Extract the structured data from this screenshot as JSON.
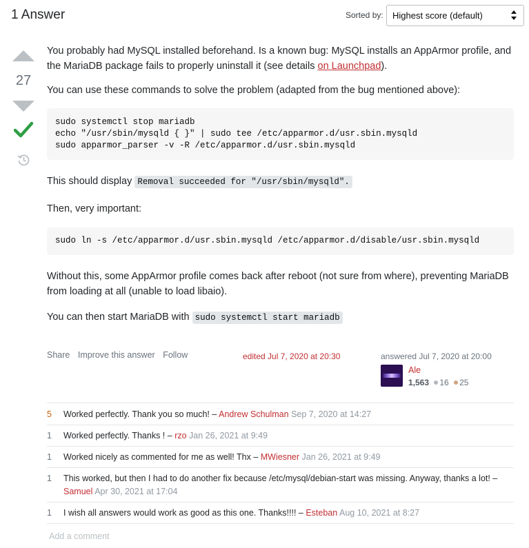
{
  "header": {
    "answers_count": "1 Answer",
    "sorted_label": "Sorted by:",
    "sort_value": "Highest score (default)"
  },
  "vote": {
    "count": "27"
  },
  "post": {
    "p1_a": "You probably had MySQL installed beforehand. Is a known bug: MySQL installs an AppArmor profile, and the MariaDB package fails to properly uninstall it (see details ",
    "p1_link": "on Launchpad",
    "p1_b": ").",
    "p2": "You can use these commands to solve the problem (adapted from the bug mentioned above):",
    "code1": "sudo systemctl stop mariadb\necho \"/usr/sbin/mysqld { }\" | sudo tee /etc/apparmor.d/usr.sbin.mysqld\nsudo apparmor_parser -v -R /etc/apparmor.d/usr.sbin.mysqld",
    "p3": "This should display ",
    "p3_code": "Removal succeeded for \"/usr/sbin/mysqld\".",
    "p4": "Then, very important:",
    "code2": "sudo ln -s /etc/apparmor.d/usr.sbin.mysqld /etc/apparmor.d/disable/usr.sbin.mysqld",
    "p5": "Without this, some AppArmor profile comes back after reboot (not sure from where), preventing MariaDB from loading at all (unable to load libaio).",
    "p6": "You can then start MariaDB with ",
    "p6_code": "sudo systemctl start mariadb"
  },
  "actions": {
    "share": "Share",
    "improve": "Improve this answer",
    "follow": "Follow"
  },
  "edited": "edited Jul 7, 2020 at 20:30",
  "answered": "answered Jul 7, 2020 at 20:00",
  "user": {
    "name": "Ale",
    "reputation": "1,563",
    "silver": "16",
    "bronze": "25"
  },
  "colors": {
    "accent_link": "#c22e32",
    "accepted_green": "#2f9e44",
    "silver": "#b4b8bc",
    "bronze": "#d1a684"
  },
  "comments": [
    {
      "score": "5",
      "text": "Worked perfectly. Thank you so much! – ",
      "user": "Andrew Schulman",
      "date": "Sep 7, 2020 at 14:27"
    },
    {
      "score": "1",
      "text": "Worked perfectly. Thanks ! – ",
      "user": "rzo",
      "date": "Jan 26, 2021 at 9:49"
    },
    {
      "score": "1",
      "text": "Worked nicely as commented for me as well! Thx – ",
      "user": "MWiesner",
      "date": "Jan 26, 2021 at 9:49"
    },
    {
      "score": "1",
      "text": "This worked, but then I had to do another fix because /etc/mysql/debian-start was missing. Anyway, thanks a lot! – ",
      "user": "Samuel",
      "date": "Apr 30, 2021 at 17:04"
    },
    {
      "score": "1",
      "text": "I wish all answers would work as good as this one. Thanks!!!! – ",
      "user": "Esteban",
      "date": "Aug 10, 2021 at 8:27"
    }
  ],
  "add_comment": "Add a comment"
}
